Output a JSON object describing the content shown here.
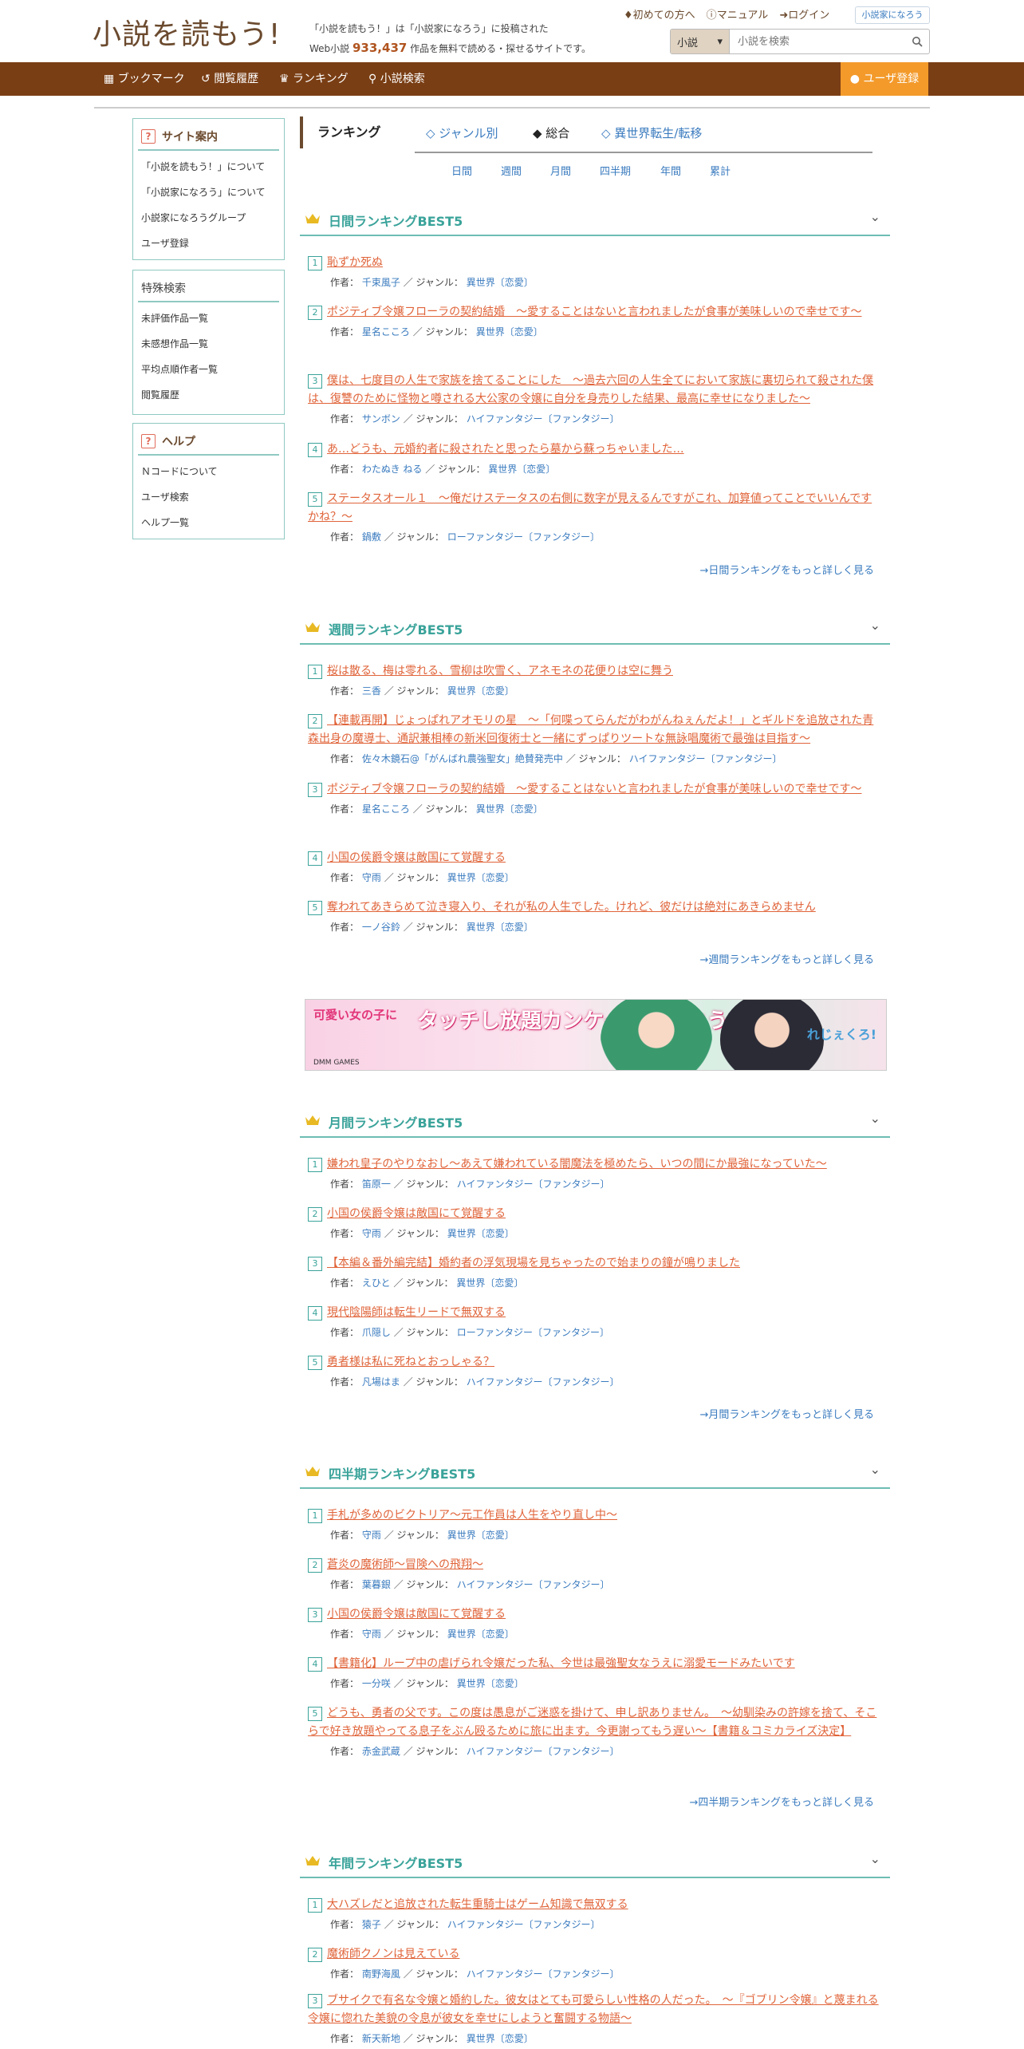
{
  "header": {
    "logo": "小説を読もう!",
    "tagline_line1": "「小説を読もう！」は「小説家になろう」に投稿された",
    "tagline_prefix": "Web小説",
    "count": "933,437",
    "tagline_suffix": "作品を無料で読める・探せるサイトです。",
    "links": [
      "初めての方へ",
      "マニュアル",
      "ログイン"
    ],
    "narou_logo": "小説家になろう",
    "search_category": "小説",
    "search_placeholder": "小説を検索"
  },
  "nav": {
    "items": [
      "ブックマーク",
      "閲覧履歴",
      "ランキング",
      "小説検索"
    ],
    "user_register": "ユーザ登録"
  },
  "sidebar": {
    "box1": {
      "title": "サイト案内",
      "items": [
        "「小説を読もう！」について",
        "「小説家になろう」について",
        "小説家になろうグループ",
        "ユーザ登録"
      ]
    },
    "box2": {
      "title": "特殊検索",
      "items": [
        "未評価作品一覧",
        "未感想作品一覧",
        "平均点順作者一覧",
        "閲覧履歴"
      ]
    },
    "box3": {
      "title": "ヘルプ",
      "items": [
        "Ｎコードについて",
        "ユーザ検索",
        "ヘルプ一覧"
      ]
    }
  },
  "main": {
    "title": "ランキング",
    "tabs": [
      "◇ ジャンル別",
      "◆ 総合",
      "◇ 異世界転生/転移"
    ],
    "periods": [
      "日間",
      "週間",
      "月間",
      "四半期",
      "年間",
      "累計"
    ],
    "author_label": "作者：",
    "genre_label": "／ ジャンル：",
    "sections": [
      {
        "title": "日間ランキングBEST5",
        "more": "→日間ランキングをもっと詳しく見る",
        "items": [
          {
            "rank": "1",
            "title": "恥ずか死ぬ",
            "author": "千束風子",
            "genre": "異世界〔恋愛〕"
          },
          {
            "rank": "2",
            "title": "ポジティブ令嬢フローラの契約結婚　～愛することはないと言われましたが食事が美味しいので幸せです～",
            "author": "星名こころ",
            "genre": "異世界〔恋愛〕"
          },
          {
            "rank": "3",
            "title": "僕は、七度目の人生で家族を捨てることにした　～過去六回の人生全てにおいて家族に裏切られて殺された僕は、復讐のために怪物と噂される大公家の令嬢に自分を身売りした結果、最高に幸せになりました～",
            "author": "サンボン",
            "genre": "ハイファンタジー〔ファンタジー〕"
          },
          {
            "rank": "4",
            "title": "あ…どうも、元婚約者に殺されたと思ったら墓から蘇っちゃいました…",
            "author": "わたぬき ねる",
            "genre": "異世界〔恋愛〕"
          },
          {
            "rank": "5",
            "title": "ステータスオール１　～俺だけステータスの右側に数字が見えるんですがこれ、加算値ってことでいいんですかね？～",
            "author": "鍋敷",
            "genre": "ローファンタジー〔ファンタジー〕"
          }
        ]
      },
      {
        "title": "週間ランキングBEST5",
        "more": "→週間ランキングをもっと詳しく見る",
        "items": [
          {
            "rank": "1",
            "title": "桜は散る、梅は零れる、雪柳は吹雪く、アネモネの花便りは空に舞う",
            "author": "三香",
            "genre": "異世界〔恋愛〕"
          },
          {
            "rank": "2",
            "title": "【連載再開】じょっぱれアオモリの星　～「何喋ってらんだがわがんねぇんだよ！」とギルドを追放された青森出身の魔導士、通訳兼相棒の新米回復術士と一緒にずっぱりツートな無詠唱魔術で最強は目指す～",
            "author": "佐々木鏡石@「がんばれ農強聖女」絶賛発売中",
            "genre": "ハイファンタジー〔ファンタジー〕"
          },
          {
            "rank": "3",
            "title": "ポジティブ令嬢フローラの契約結婚　～愛することはないと言われましたが食事が美味しいので幸せです～",
            "author": "星名こころ",
            "genre": "異世界〔恋愛〕"
          },
          {
            "rank": "4",
            "title": "小国の侯爵令嬢は敵国にて覚醒する",
            "author": "守雨",
            "genre": "異世界〔恋愛〕"
          },
          {
            "rank": "5",
            "title": "奪われてあきらめて泣き寝入り、それが私の人生でした。けれど、彼だけは絶対にあきらめません",
            "author": "一ノ谷鈴",
            "genre": "異世界〔恋愛〕"
          }
        ]
      },
      {
        "title": "月間ランキングBEST5",
        "more": "→月間ランキングをもっと詳しく見る",
        "items": [
          {
            "rank": "1",
            "title": "嫌われ皇子のやりなおし～あえて嫌われている闇魔法を極めたら、いつの間にか最強になっていた～",
            "author": "笛原一",
            "genre": "ハイファンタジー〔ファンタジー〕"
          },
          {
            "rank": "2",
            "title": "小国の侯爵令嬢は敵国にて覚醒する",
            "author": "守雨",
            "genre": "異世界〔恋愛〕"
          },
          {
            "rank": "3",
            "title": "【本編＆番外編完結】婚約者の浮気現場を見ちゃったので始まりの鐘が鳴りました",
            "author": "えひと",
            "genre": "異世界〔恋愛〕"
          },
          {
            "rank": "4",
            "title": "現代陰陽師は転生リードで無双する",
            "author": "爪隠し",
            "genre": "ローファンタジー〔ファンタジー〕"
          },
          {
            "rank": "5",
            "title": "勇者様は私に死ねとおっしゃる？",
            "author": "凡場はま",
            "genre": "ハイファンタジー〔ファンタジー〕"
          }
        ]
      },
      {
        "title": "四半期ランキングBEST5",
        "more": "→四半期ランキングをもっと詳しく見る",
        "items": [
          {
            "rank": "1",
            "title": "手札が多めのビクトリア～元工作員は人生をやり直し中～",
            "author": "守雨",
            "genre": "異世界〔恋愛〕"
          },
          {
            "rank": "2",
            "title": "蒼炎の魔術師～冒険への飛翔～",
            "author": "葉暮銀",
            "genre": "ハイファンタジー〔ファンタジー〕"
          },
          {
            "rank": "3",
            "title": "小国の侯爵令嬢は敵国にて覚醒する",
            "author": "守雨",
            "genre": "異世界〔恋愛〕"
          },
          {
            "rank": "4",
            "title": "【書籍化】ループ中の虐げられ令嬢だった私、今世は最強聖女なうえに溺愛モードみたいです",
            "author": "一分咲",
            "genre": "異世界〔恋愛〕"
          },
          {
            "rank": "5",
            "title": "どうも、勇者の父です。この度は愚息がご迷惑を掛けて、申し訳ありません。　～幼馴染みの許嫁を捨て、そこらで好き放題やってる息子をぶん殴るために旅に出ます。今更謝ってもう遅い～【書籍＆コミカライズ決定】",
            "author": "赤金武蔵",
            "genre": "ハイファンタジー〔ファンタジー〕"
          }
        ]
      },
      {
        "title": "年間ランキングBEST5",
        "more": "",
        "items": [
          {
            "rank": "1",
            "title": "大ハズレだと追放された転生重騎士はゲーム知識で無双する",
            "author": "猿子",
            "genre": "ハイファンタジー〔ファンタジー〕"
          },
          {
            "rank": "2",
            "title": "魔術師クノンは見えている",
            "author": "南野海風",
            "genre": "ハイファンタジー〔ファンタジー〕"
          },
          {
            "rank": "3",
            "title": "ブサイクで有名な令嬢と婚約した。彼女はとても可愛らしい性格の人だった。　～『ゴブリン令嬢』と蔑まれる令嬢に惚れた美貌の令息が彼女を幸せにしようと奮闘する物語～",
            "author": "新天新地",
            "genre": "異世界〔恋愛〕"
          }
        ]
      }
    ]
  },
  "banner": {
    "text1": "可愛い女の子に",
    "text2": "タッチし放題カンケイを深めよう",
    "brand": "れじぇくろ!",
    "maker": "DMM GAMES"
  },
  "colors": {
    "nav_bg": "#7a3e14",
    "accent_orange": "#f39a2b",
    "title_orange": "#e0643a",
    "teal": "#3aa39a",
    "link_blue": "#3a7bbf"
  }
}
